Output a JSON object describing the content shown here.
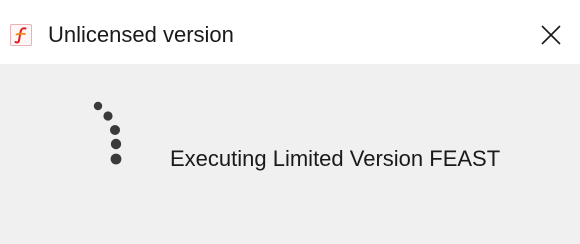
{
  "window": {
    "title": "Unlicensed version",
    "icon": "feast-app-icon",
    "close_icon": "close-icon"
  },
  "content": {
    "spinner_icon": "loading-spinner-icon",
    "message": "Executing Limited Version FEAST"
  },
  "colors": {
    "titlebar_bg": "#ffffff",
    "content_bg": "#f0f0f0",
    "text": "#1a1a1a",
    "icon_accent_red": "#e02020",
    "icon_accent_orange": "#f08a1c",
    "spinner": "#3a3a3a"
  }
}
